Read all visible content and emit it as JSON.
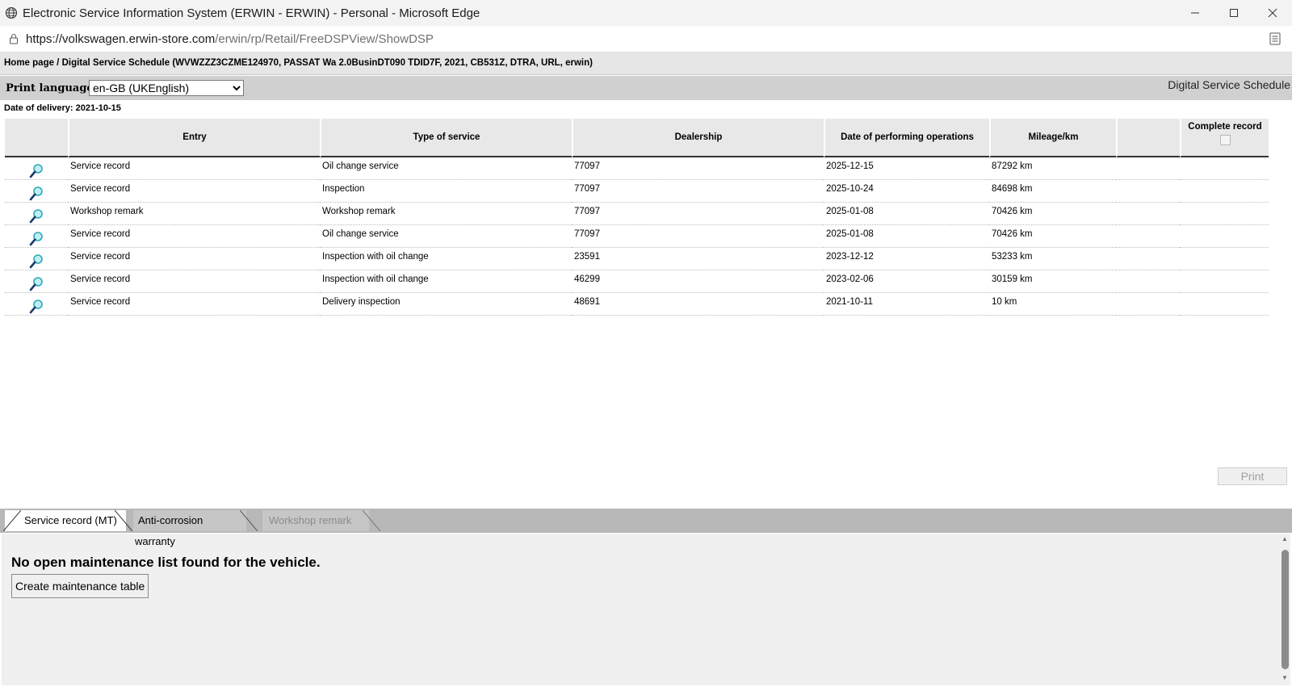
{
  "window": {
    "title": "Electronic Service Information System (ERWIN - ERWIN) - Personal - Microsoft Edge"
  },
  "address": {
    "url_host": "https://volkswagen.erwin-store.com",
    "url_path": "/erwin/rp/Retail/FreeDSPView/ShowDSP"
  },
  "breadcrumb": "Home page / Digital Service Schedule (WVWZZZ3CZME124970, PASSAT Wa 2.0BusinDT090 TDID7F, 2021, CB531Z, DTRA, URL, erwin)",
  "langbar": {
    "label": "Print language:",
    "selected": "en-GB (UKEnglish)",
    "section_title": "Digital Service Schedule"
  },
  "delivery": "Date of delivery: 2021-10-15",
  "table": {
    "headers": {
      "entry": "Entry",
      "type": "Type of service",
      "dealership": "Dealership",
      "date": "Date of performing operations",
      "mileage": "Mileage/km",
      "complete": "Complete record"
    },
    "rows": [
      {
        "entry": "Service record",
        "type": "Oil change service",
        "dealership": "77097",
        "date": "2025-12-15",
        "mileage": "87292 km"
      },
      {
        "entry": "Service record",
        "type": "Inspection",
        "dealership": "77097",
        "date": "2025-10-24",
        "mileage": "84698 km"
      },
      {
        "entry": "Workshop remark",
        "type": "Workshop remark",
        "dealership": "77097",
        "date": "2025-01-08",
        "mileage": "70426 km"
      },
      {
        "entry": "Service record",
        "type": "Oil change service",
        "dealership": "77097",
        "date": "2025-01-08",
        "mileage": "70426 km"
      },
      {
        "entry": "Service record",
        "type": "Inspection with oil change",
        "dealership": "23591",
        "date": "2023-12-12",
        "mileage": "53233 km"
      },
      {
        "entry": "Service record",
        "type": "Inspection with oil change",
        "dealership": "46299",
        "date": "2023-02-06",
        "mileage": "30159 km"
      },
      {
        "entry": "Service record",
        "type": "Delivery inspection",
        "dealership": "48691",
        "date": "2021-10-11",
        "mileage": "10 km"
      }
    ]
  },
  "print_label": "Print",
  "tabs": [
    {
      "label": "Service record (MT)"
    },
    {
      "label": "Anti-corrosion warranty"
    },
    {
      "label": "Workshop remark"
    }
  ],
  "bottom": {
    "message": "No open maintenance list found for the vehicle.",
    "create_label": "Create maintenance table"
  },
  "colors": {
    "magnifier": "#2aa8b8",
    "header_bg": "#e8e8e8",
    "tabstrip_bg": "#b8b8b8"
  }
}
